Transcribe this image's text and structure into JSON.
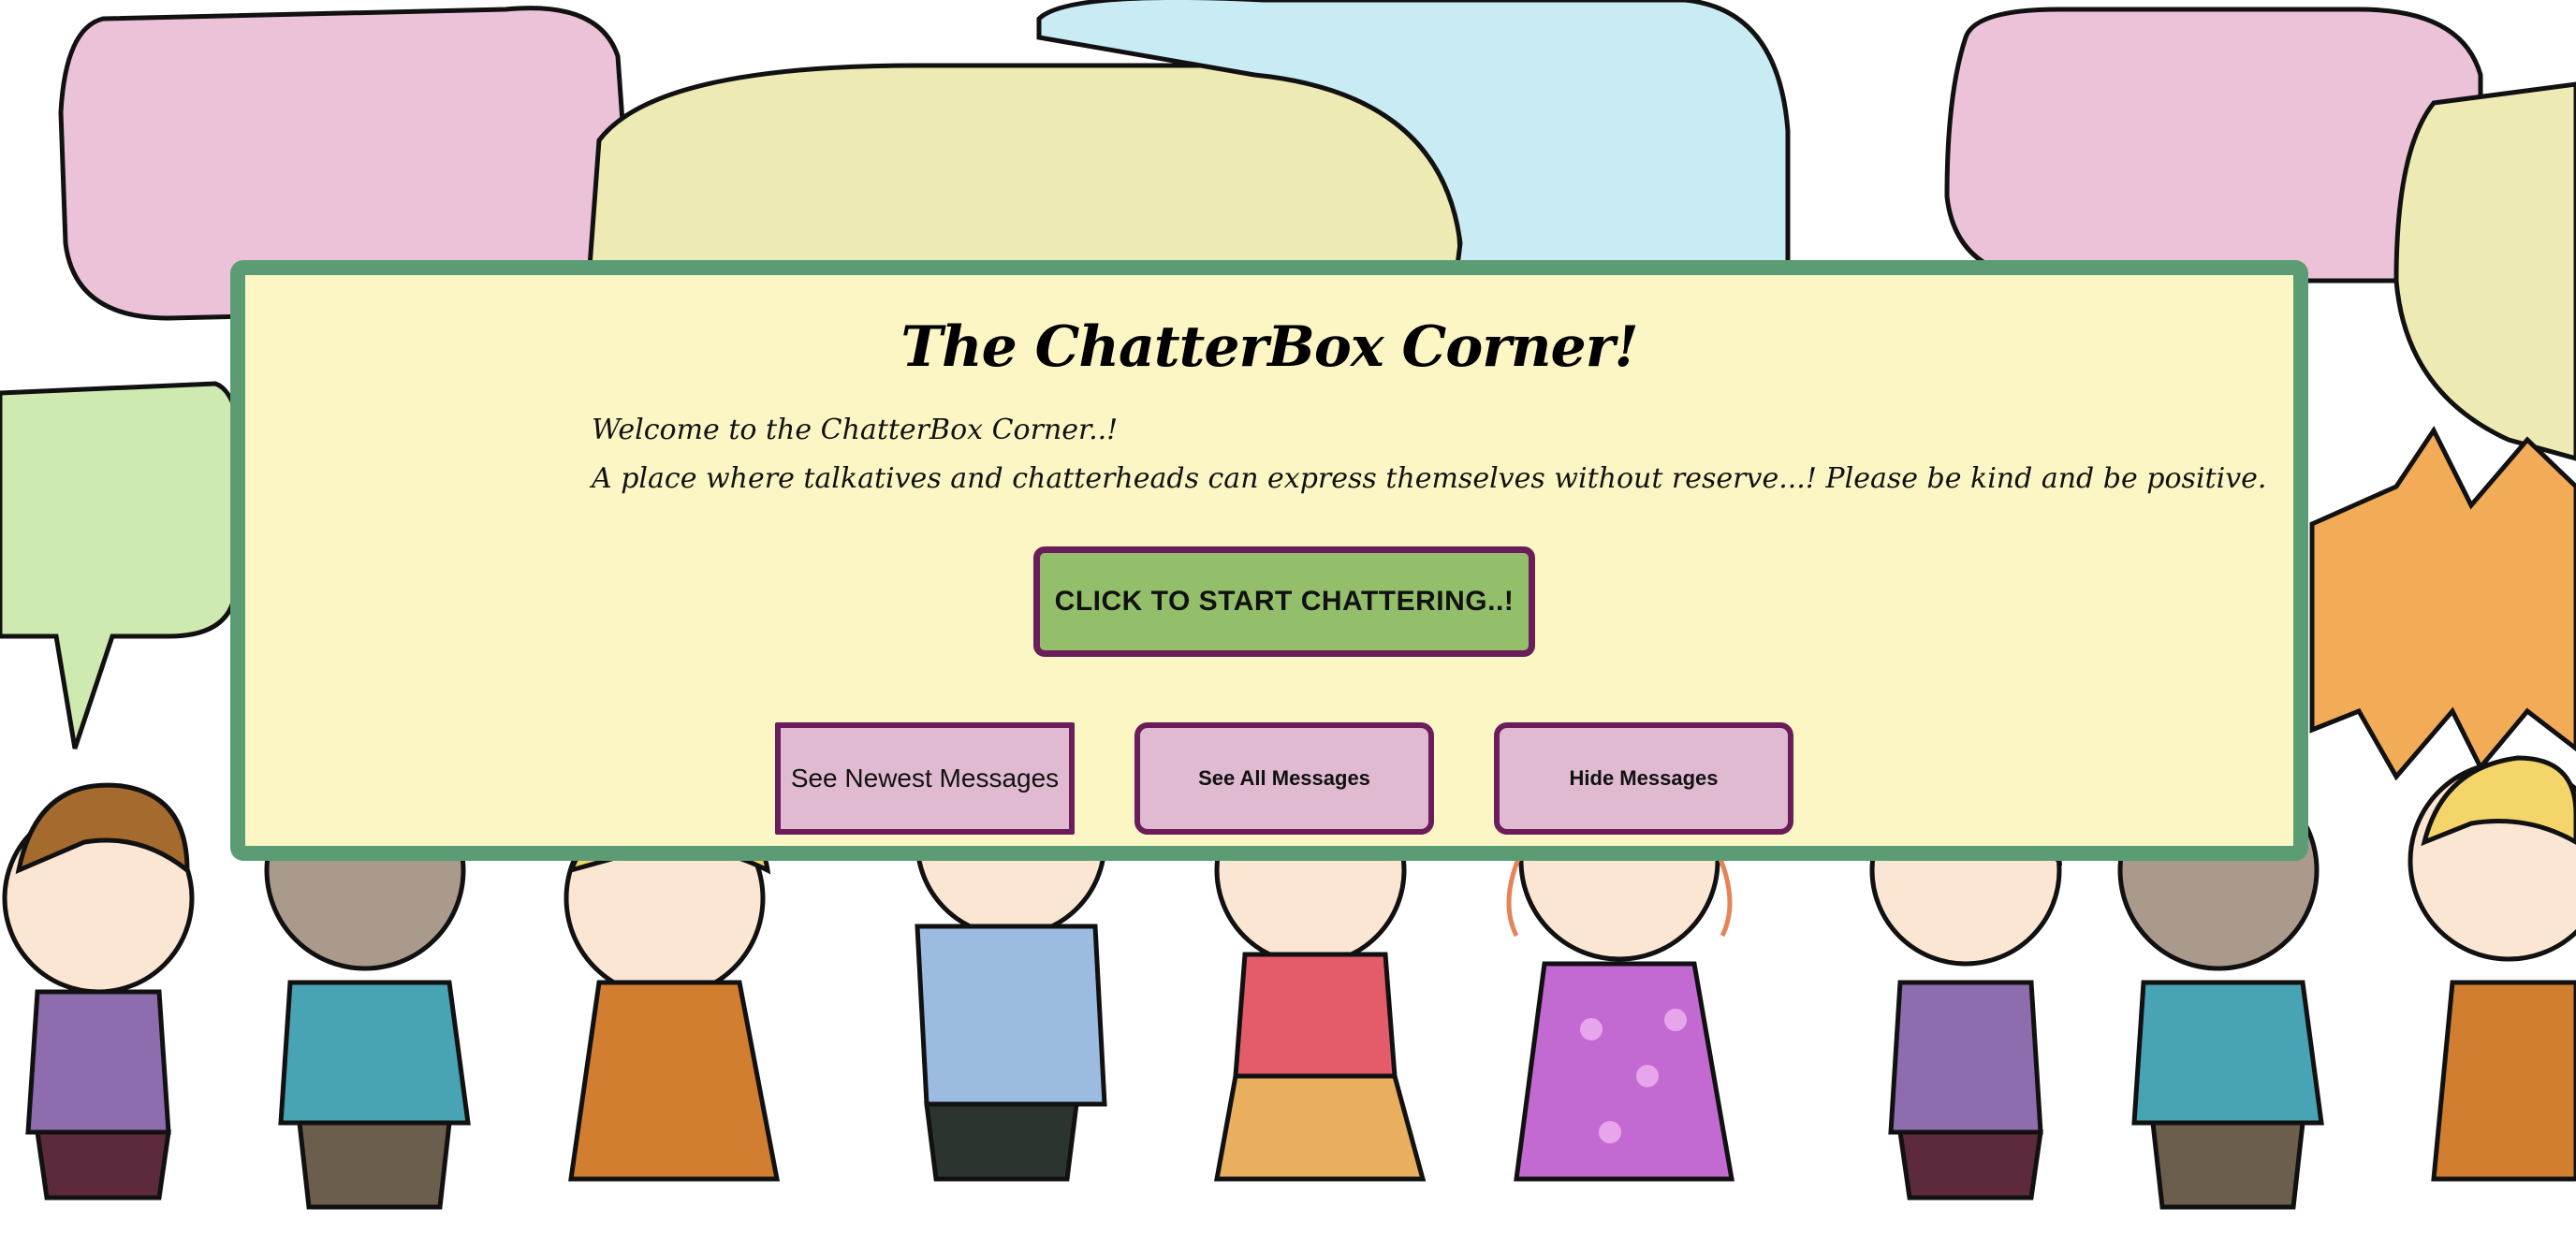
{
  "page": {
    "title": "The ChatterBox Corner!",
    "welcome_line_1": "Welcome to the ChatterBox Corner..!",
    "welcome_line_2": "A place where talkatives and chatterheads can express themselves without reserve...! Please be kind and be positive."
  },
  "actions": {
    "start_label": "CLICK TO START CHATTERING..!",
    "see_newest_label": "See Newest Messages",
    "see_all_label": "See All Messages",
    "hide_label": "Hide Messages"
  },
  "colors": {
    "panel_background": "#fcf6c4",
    "panel_border": "#5b9c74",
    "start_button": "#94bf6a",
    "message_buttons": "#e0bad0",
    "button_border": "#6b1c5b"
  },
  "background": {
    "illustration": "children-holding-hands-with-speech-bubbles"
  }
}
